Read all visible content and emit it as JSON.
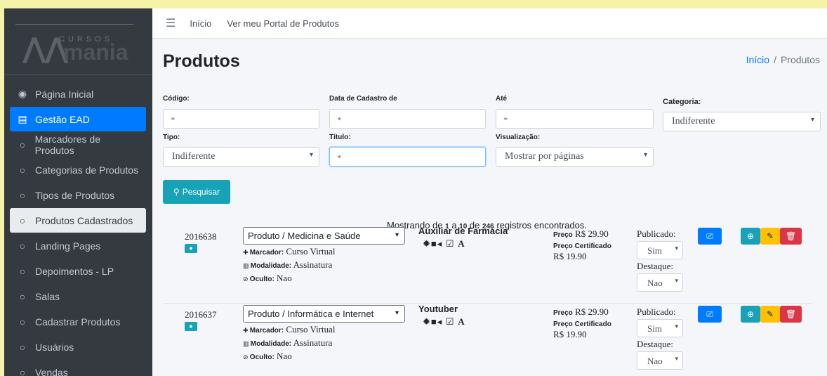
{
  "brand": {
    "sub": "CURSOS",
    "main": "mania"
  },
  "sidebar": {
    "items": [
      {
        "label": "Página Inicial",
        "icon": "tachometer-icon",
        "glyph": "◉",
        "state": ""
      },
      {
        "label": "Gestão EAD",
        "icon": "book-icon",
        "glyph": "▤",
        "state": "active"
      },
      {
        "label": "Marcadores de Produtos",
        "icon": "circle-icon",
        "glyph": "○",
        "state": ""
      },
      {
        "label": "Categorias de Produtos",
        "icon": "circle-icon",
        "glyph": "○",
        "state": ""
      },
      {
        "label": "Tipos de Produtos",
        "icon": "circle-icon",
        "glyph": "○",
        "state": ""
      },
      {
        "label": "Produtos Cadastrados",
        "icon": "circle-icon",
        "glyph": "○",
        "state": "selected"
      },
      {
        "label": "Landing Pages",
        "icon": "circle-icon",
        "glyph": "○",
        "state": ""
      },
      {
        "label": "Depoimentos - LP",
        "icon": "circle-icon",
        "glyph": "○",
        "state": ""
      },
      {
        "label": "Salas",
        "icon": "circle-icon",
        "glyph": "○",
        "state": ""
      },
      {
        "label": "Cadastrar Produtos",
        "icon": "circle-icon",
        "glyph": "○",
        "state": ""
      },
      {
        "label": "Usuários",
        "icon": "circle-icon",
        "glyph": "○",
        "state": ""
      },
      {
        "label": "Vendas",
        "icon": "circle-icon",
        "glyph": "○",
        "state": ""
      }
    ]
  },
  "topbar": {
    "home": "Início",
    "portal": "Ver meu Portal de Produtos"
  },
  "page": {
    "title": "Produtos",
    "breadcrumb_home": "Início",
    "breadcrumb_sep": "/",
    "breadcrumb_current": "Produtos"
  },
  "filters": {
    "codigo_label": "Código:",
    "codigo_placeholder": "*",
    "data_label": "Data de Cadastro de",
    "data_placeholder": "*",
    "ate_label": "Até",
    "ate_placeholder": "*",
    "categoria_label": "Categoria:",
    "categoria_value": "Indiferente",
    "tipo_label": "Tipo:",
    "tipo_value": "Indiferente",
    "titulo_label": "Título:",
    "titulo_value": "*",
    "visualizacao_label": "Visualização:",
    "visualizacao_value": "Mostrar por páginas",
    "search_button": "Pesquisar"
  },
  "results": {
    "prefix": "Mostrando de",
    "from": "1",
    "mid": "a",
    "to": "10",
    "of": "de",
    "total": "246",
    "suffix": "registros encontrados."
  },
  "products": [
    {
      "code": "2016638",
      "category": "Produto / Medicina e Saúde",
      "marcador_k": "Marcador:",
      "marcador": "Curso Virtual",
      "modalidade_k": "Modalidade:",
      "modalidade": "Assinatura",
      "oculto_k": "Oculto:",
      "oculto": "Nao",
      "title": "Auxiliar de Farmácia",
      "price_k": "Preço",
      "price": "R$ 29.90",
      "cert_k": "Preço Certificado",
      "cert": "R$ 19.90",
      "publicado_k": "Publicado:",
      "publicado": "Sim",
      "destaque_k": "Destaque:",
      "destaque": "Nao"
    },
    {
      "code": "2016637",
      "category": "Produto / Informática e Internet",
      "marcador_k": "Marcador:",
      "marcador": "Curso Virtual",
      "modalidade_k": "Modalidade:",
      "modalidade": "Assinatura",
      "oculto_k": "Oculto:",
      "oculto": "Nao",
      "title": "Youtuber",
      "price_k": "Preço",
      "price": "R$ 29.90",
      "cert_k": "Preço Certificado",
      "cert": "R$ 19.90",
      "publicado_k": "Publicado:",
      "publicado": "Sim",
      "destaque_k": "Destaque:",
      "destaque": "Nao"
    }
  ],
  "colors": {
    "primary": "#007bff",
    "info": "#17a2b8",
    "warning": "#ffc107",
    "danger": "#dc3545",
    "sidebar": "#343a40"
  }
}
